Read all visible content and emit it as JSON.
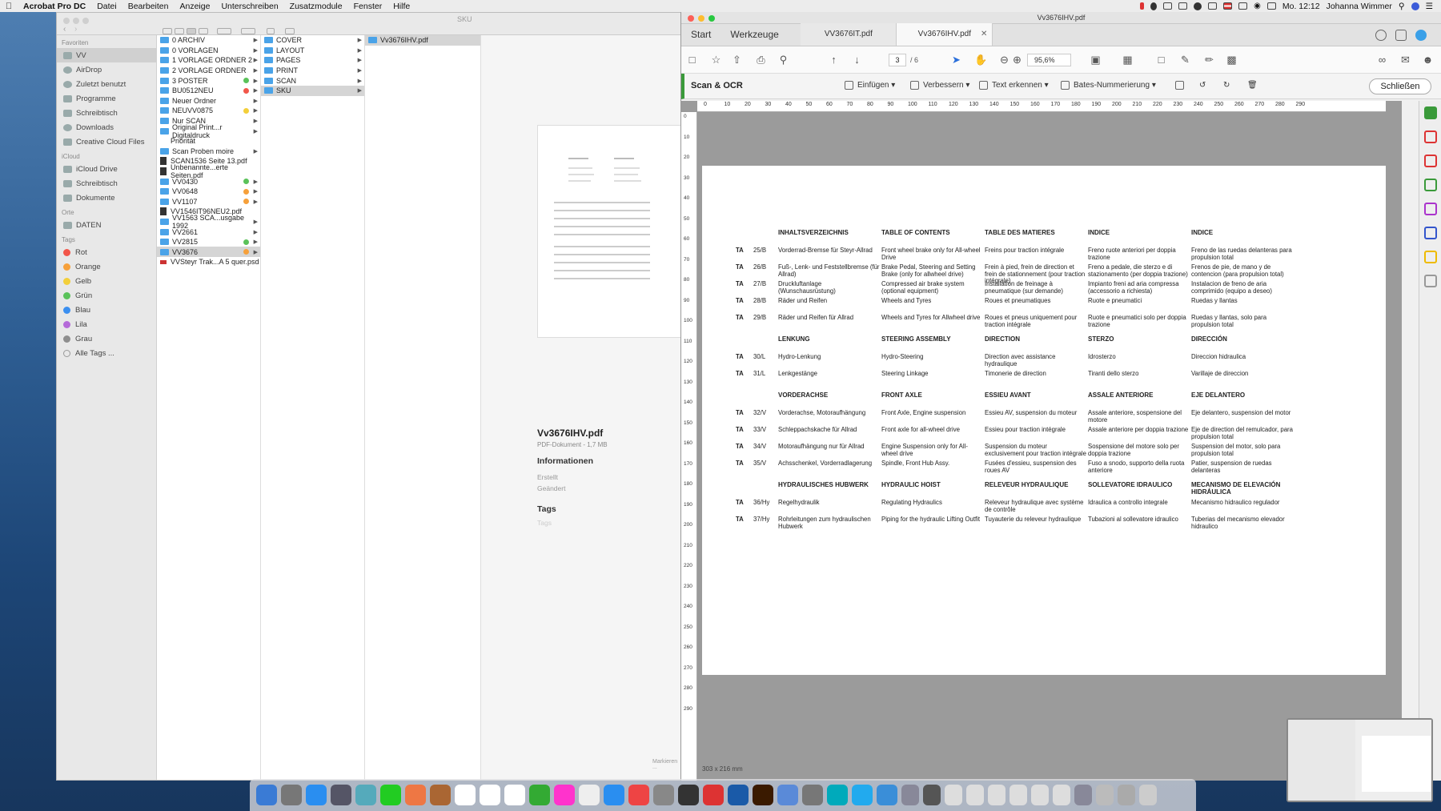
{
  "menubar": {
    "items": [
      "Acrobat Pro DC",
      "Datei",
      "Bearbeiten",
      "Anzeige",
      "Unterschreiben",
      "Zusatzmodule",
      "Fenster",
      "Hilfe"
    ],
    "clock": "Mo. 12:12",
    "user": "Johanna Wimmer"
  },
  "finder": {
    "title": "SKU",
    "sidebar": {
      "favorites_label": "Favoriten",
      "favorites": [
        "VV",
        "AirDrop",
        "Zuletzt benutzt",
        "Programme",
        "Schreibtisch",
        "Downloads",
        "Creative Cloud Files"
      ],
      "icloud_label": "iCloud",
      "icloud": [
        "iCloud Drive",
        "Schreibtisch",
        "Dokumente"
      ],
      "places_label": "Orte",
      "places": [
        "DATEN"
      ],
      "tags_label": "Tags",
      "tags": [
        {
          "name": "Rot",
          "color": "#f2564a"
        },
        {
          "name": "Orange",
          "color": "#f6a03a"
        },
        {
          "name": "Gelb",
          "color": "#f3cf3a"
        },
        {
          "name": "Grün",
          "color": "#5ac25a"
        },
        {
          "name": "Blau",
          "color": "#3b8ff0"
        },
        {
          "name": "Lila",
          "color": "#b56ad9"
        },
        {
          "name": "Grau",
          "color": "#8e8e8e"
        },
        {
          "name": "Alle Tags ...",
          "color": ""
        }
      ]
    },
    "col1": [
      {
        "name": "0 ARCHIV",
        "type": "folder"
      },
      {
        "name": "0 VORLAGEN",
        "type": "folder"
      },
      {
        "name": "1 VORLAGE ORDNER 2",
        "type": "folder"
      },
      {
        "name": "2 VORLAGE ORDNER",
        "type": "folder"
      },
      {
        "name": "3 POSTER",
        "type": "folder",
        "tag": "#5ac25a"
      },
      {
        "name": "BU0512NEU",
        "type": "folder",
        "tag": "#f2564a"
      },
      {
        "name": "Neuer Ordner",
        "type": "folder"
      },
      {
        "name": "NEUVV0875",
        "type": "folder",
        "tag": "#f3cf3a"
      },
      {
        "name": "Nur SCAN",
        "type": "folder"
      },
      {
        "name": "Original Print...r Digitaldruck",
        "type": "folder"
      },
      {
        "name": "Priorität",
        "type": "file-blank"
      },
      {
        "name": "Scan Proben moire",
        "type": "folder"
      },
      {
        "name": "SCAN1536 Seite 13.pdf",
        "type": "pdf"
      },
      {
        "name": "Unbenannte...erte Seiten.pdf",
        "type": "pdf"
      },
      {
        "name": "VV0430",
        "type": "folder",
        "tag": "#5ac25a"
      },
      {
        "name": "VV0648",
        "type": "folder",
        "tag": "#f6a03a"
      },
      {
        "name": "VV1107",
        "type": "folder",
        "tag": "#f6a03a"
      },
      {
        "name": "VV1546IT96NEU2.pdf",
        "type": "pdf"
      },
      {
        "name": "VV1563 SCA...usgabe 1992",
        "type": "folder"
      },
      {
        "name": "VV2661",
        "type": "folder"
      },
      {
        "name": "VV2815",
        "type": "folder",
        "tag": "#5ac25a"
      },
      {
        "name": "VV3676",
        "type": "folder",
        "tag": "#f6a03a",
        "selected": true
      },
      {
        "name": "VVSteyr Trak...A 5 quer.psd",
        "type": "psd"
      }
    ],
    "col2": [
      {
        "name": "COVER"
      },
      {
        "name": "LAYOUT"
      },
      {
        "name": "PAGES"
      },
      {
        "name": "PRINT"
      },
      {
        "name": "SCAN"
      },
      {
        "name": "SKU",
        "selected": true
      }
    ],
    "col3": [
      {
        "name": "Vv3676IHV.pdf",
        "selected": true
      }
    ],
    "preview": {
      "filename": "Vv3676IHV.pdf",
      "subtitle": "PDF-Dokument - 1,7 MB",
      "info_heading": "Informationen",
      "created": "Erstellt",
      "modified": "Geändert",
      "tags_heading": "Tags",
      "tags_placeholder": "Tags",
      "more": "Markieren ..."
    }
  },
  "acrobat": {
    "window_title": "Vv3676IHV.pdf",
    "tabs": {
      "start": "Start",
      "tools": "Werkzeuge",
      "doc1": "VV3676IT.pdf",
      "doc2": "Vv3676IHV.pdf"
    },
    "page_current": "3",
    "page_total": "/ 6",
    "zoom": "95,6%",
    "ocr": {
      "title": "Scan & OCR",
      "insert": "Einfügen",
      "improve": "Verbessern",
      "recognize": "Text erkennen",
      "bates": "Bates-Nummerierung",
      "close": "Schließen"
    },
    "ruler_marks": [
      "0",
      "10",
      "20",
      "30",
      "40",
      "50",
      "60",
      "70",
      "80",
      "90",
      "100",
      "110",
      "120",
      "130",
      "140",
      "150",
      "160",
      "170",
      "180",
      "190",
      "200",
      "210",
      "220",
      "230",
      "240",
      "250",
      "260",
      "270",
      "280",
      "290"
    ],
    "page_size": "303 x 216 mm",
    "doc": {
      "headers": [
        "INHALTSVERZEICHNIS",
        "TABLE OF CONTENTS",
        "TABLE DES MATIERES",
        "INDICE",
        "INDICE"
      ],
      "sections": [
        {
          "heads": null,
          "rows": [
            {
              "ta": "TA",
              "code": "25/B",
              "c": [
                "Vorderrad-Bremse für Steyr-Allrad",
                "Front wheel brake only for All-wheel Drive",
                "Freins pour traction intégrale",
                "Freno ruote anteriori per doppia trazione",
                "Freno de las ruedas delanteras para propulsion total"
              ]
            },
            {
              "ta": "TA",
              "code": "26/B",
              "c": [
                "Fuß-, Lenk- und Feststellbremse (für Allrad)",
                "Brake Pedal, Steering and Setting Brake (only for allwheel drive)",
                "Frein à pied, frein de direction et frein de stationnement (pour traction intégrale)",
                "Freno a pedale, die sterzo e di stazionamento (per doppia trazione)",
                "Frenos de pie, de mano y de contencion (para propulsion total)"
              ]
            },
            {
              "ta": "TA",
              "code": "27/B",
              "c": [
                "Druckluftanlage (Wunschausrüstung)",
                "Compressed air brake system (optional equipment)",
                "Installation de freinage à pneumatique (sur demande)",
                "Impianto freni ad aria compressa (accessorio a richiesta)",
                "Instalacion de freno de aria comprimido (equipo a deseo)"
              ]
            },
            {
              "ta": "TA",
              "code": "28/B",
              "c": [
                "Räder und Reifen",
                "Wheels and Tyres",
                "Roues et pneumatiques",
                "Ruote e pneumatici",
                "Ruedas y llantas"
              ]
            },
            {
              "ta": "TA",
              "code": "29/B",
              "c": [
                "Räder und Reifen für Allrad",
                "Wheels and Tyres for Allwheel drive",
                "Roues et pneus uniquement pour traction intégrale",
                "Ruote e pneumatici solo per doppia trazione",
                "Ruedas y llantas, solo para propulsion total"
              ]
            }
          ]
        },
        {
          "heads": [
            "LENKUNG",
            "STEERING ASSEMBLY",
            "DIRECTION",
            "STERZO",
            "DIRECCIÓN"
          ],
          "rows": [
            {
              "ta": "TA",
              "code": "30/L",
              "c": [
                "Hydro-Lenkung",
                "Hydro-Steering",
                "Direction avec assistance hydraulique",
                "Idrosterzo",
                "Direccion hidraulica"
              ]
            },
            {
              "ta": "TA",
              "code": "31/L",
              "c": [
                "Lenkgestänge",
                "Steering Linkage",
                "Timonerie de direction",
                "Tiranti dello sterzo",
                "Varillaje de direccion"
              ]
            }
          ]
        },
        {
          "heads": [
            "VORDERACHSE",
            "FRONT AXLE",
            "ESSIEU AVANT",
            "ASSALE ANTERIORE",
            "EJE DELANTERO"
          ],
          "rows": [
            {
              "ta": "TA",
              "code": "32/V",
              "c": [
                "Vorderachse, Motoraufhängung",
                "Front Axle, Engine suspension",
                "Essieu AV, suspension du moteur",
                "Assale anteriore, sospensione del motore",
                "Eje delantero, suspension del motor"
              ]
            },
            {
              "ta": "TA",
              "code": "33/V",
              "c": [
                "Schleppachskache für Allrad",
                "Front axle for all-wheel drive",
                "Essieu pour traction intégrale",
                "Assale anteriore per doppia trazione",
                "Eje de direction del remulcador, para propulsion total"
              ]
            },
            {
              "ta": "TA",
              "code": "34/V",
              "c": [
                "Motoraufhängung nur für Allrad",
                "Engine Suspension only for All-wheel drive",
                "Suspension du moteur exclusivement pour traction intégrale",
                "Sospensione del motore solo per doppia trazione",
                "Suspension del motor, solo para propulsion total"
              ]
            },
            {
              "ta": "TA",
              "code": "35/V",
              "c": [
                "Achsschenkel, Vorderradlagerung",
                "Spindle, Front Hub Assy.",
                "Fusées d'essieu, suspension des roues AV",
                "Fuso a snodo, supporto della ruota anteriore",
                "Patier, suspension de ruedas delanteras"
              ]
            }
          ]
        },
        {
          "heads": [
            "HYDRAULISCHES HUBWERK",
            "HYDRAULIC HOIST",
            "RELEVEUR HYDRAULIQUE",
            "SOLLEVATORE IDRAULICO",
            "MECANISMO DE ELEVACIÓN HIDRÁULICA"
          ],
          "rows": [
            {
              "ta": "TA",
              "code": "36/Hy",
              "c": [
                "Regelhydraulik",
                "Regulating Hydraulics",
                "Releveur hydraulique avec système de contrôle",
                "Idraulica a controllo integrale",
                "Mecanismo hidraulico regulador"
              ]
            },
            {
              "ta": "TA",
              "code": "37/Hy",
              "c": [
                "Rohrleitungen zum hydraulischen Hubwerk",
                "Piping for the hydraulic Lifting Outfit",
                "Tuyauterie du releveur hydraulique",
                "Tubazioni al sollevatore idraulico",
                "Tuberias del mecanismo elevador hidraulico"
              ]
            }
          ]
        }
      ]
    }
  }
}
